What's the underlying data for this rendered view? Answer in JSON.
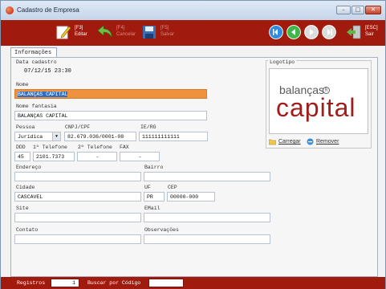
{
  "window": {
    "title": "Cadastro de Empresa",
    "controls": {
      "minimize": "–",
      "maximize": "□",
      "close": "✕"
    }
  },
  "toolbar": {
    "buttons": [
      {
        "key": "[F3]",
        "label": "Editar",
        "icon": "edit-icon",
        "enabled": true
      },
      {
        "key": "[F4]",
        "label": "Cancelar",
        "icon": "undo-arrow-icon",
        "enabled": false
      },
      {
        "key": "[F5]",
        "label": "Salvar",
        "icon": "floppy-disk-icon",
        "enabled": false
      }
    ],
    "nav_icons": [
      "nav-first-icon",
      "nav-previous-icon",
      "nav-next-icon",
      "nav-last-icon"
    ],
    "exit": {
      "key": "[ESC]",
      "label": "Sair",
      "icon": "exit-door-icon"
    }
  },
  "tabs": [
    {
      "label": "Informações",
      "active": true
    }
  ],
  "form": {
    "data_cadastro_label": "Data cadastro",
    "data_cadastro_value": "07/12/15 23:30",
    "nome_label": "Nome",
    "nome_value": "BALANÇAS CAPITAL",
    "fantasia_label": "Nome fantasia",
    "fantasia_value": "BALANÇAS CAPITAL",
    "pessoa_label": "Pessoa",
    "pessoa_value": "Jurídica",
    "cnpj_label": "CNPJ/CPF",
    "cnpj_value": "82.679.036/0001-08",
    "ie_label": "IE/RG",
    "ie_value": "111111111111",
    "ddd_label": "DDD",
    "tel1_label": "1º Telefone",
    "tel2_label": "2º Telefone",
    "fax_label": "FAX",
    "ddd_value": "45",
    "tel1_value": "2101.7373",
    "tel2_value": "-",
    "fax_value": "-",
    "endereco_label": "Endereço",
    "endereco_value": "",
    "bairro_label": "Bairro",
    "bairro_value": "",
    "cidade_label": "Cidade",
    "cidade_value": "CASCAVEL",
    "uf_label": "UF",
    "uf_value": "PR",
    "cep_label": "CEP",
    "cep_value": "00000-000",
    "site_label": "Site",
    "site_value": "",
    "email_label": "EMail",
    "email_value": "",
    "contato_label": "Contato",
    "contato_value": "",
    "obs_label": "Observações",
    "obs_value": ""
  },
  "logo": {
    "label": "Logotipo",
    "image_small_text": "balanças",
    "image_big_text": "capital",
    "image_reg": "R",
    "load_label": "Carregar",
    "remove_label": "Remover"
  },
  "statusbar": {
    "records_label": "Registros",
    "records_value": "1",
    "search_label": "Buscar por Código",
    "search_value": ""
  },
  "colors": {
    "toolbar_bg": "#a01a0d",
    "selection_bg": "#f0913e",
    "logo_red": "#a31c1c"
  }
}
